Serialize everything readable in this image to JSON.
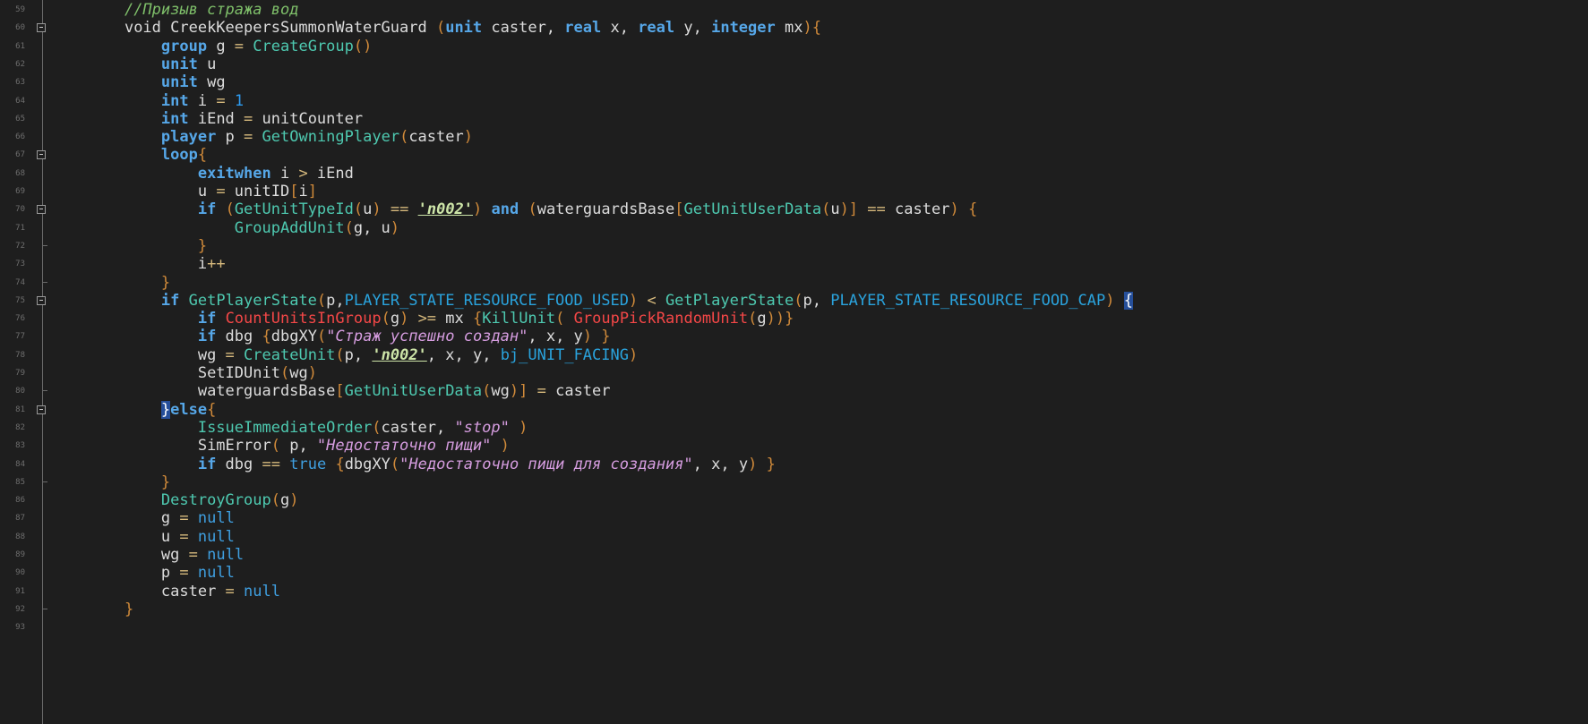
{
  "editor": {
    "lines": [
      {
        "n": "59",
        "fold": "none",
        "tokens": [
          [
            "",
            "    "
          ],
          [
            "cmt",
            "//Призыв стража вод"
          ]
        ]
      },
      {
        "n": "60",
        "fold": "open",
        "tokens": [
          [
            "",
            "    "
          ],
          [
            "id",
            "void CreekKeepersSummonWaterGuard "
          ],
          [
            "pun",
            "("
          ],
          [
            "type",
            "unit"
          ],
          [
            "id",
            " caster, "
          ],
          [
            "type",
            "real"
          ],
          [
            "id",
            " x, "
          ],
          [
            "type",
            "real"
          ],
          [
            "id",
            " y, "
          ],
          [
            "type",
            "integer"
          ],
          [
            "id",
            " mx"
          ],
          [
            "pun",
            "){"
          ]
        ]
      },
      {
        "n": "61",
        "fold": "none",
        "tokens": [
          [
            "",
            "        "
          ],
          [
            "type",
            "group"
          ],
          [
            "id",
            " g "
          ],
          [
            "op",
            "="
          ],
          [
            "id",
            " "
          ],
          [
            "fn",
            "CreateGroup"
          ],
          [
            "pun",
            "()"
          ]
        ]
      },
      {
        "n": "62",
        "fold": "none",
        "tokens": [
          [
            "",
            "        "
          ],
          [
            "type",
            "unit"
          ],
          [
            "id",
            " u"
          ]
        ]
      },
      {
        "n": "63",
        "fold": "none",
        "tokens": [
          [
            "",
            "        "
          ],
          [
            "type",
            "unit"
          ],
          [
            "id",
            " wg"
          ]
        ]
      },
      {
        "n": "64",
        "fold": "none",
        "tokens": [
          [
            "",
            "        "
          ],
          [
            "type",
            "int"
          ],
          [
            "id",
            " i "
          ],
          [
            "op",
            "="
          ],
          [
            "id",
            " "
          ],
          [
            "num",
            "1"
          ]
        ]
      },
      {
        "n": "65",
        "fold": "none",
        "tokens": [
          [
            "",
            "        "
          ],
          [
            "type",
            "int"
          ],
          [
            "id",
            " iEnd "
          ],
          [
            "op",
            "="
          ],
          [
            "id",
            " unitCounter"
          ]
        ]
      },
      {
        "n": "66",
        "fold": "none",
        "tokens": [
          [
            "",
            "        "
          ],
          [
            "type",
            "player"
          ],
          [
            "id",
            " p "
          ],
          [
            "op",
            "="
          ],
          [
            "id",
            " "
          ],
          [
            "fn",
            "GetOwningPlayer"
          ],
          [
            "pun",
            "("
          ],
          [
            "id",
            "caster"
          ],
          [
            "pun",
            ")"
          ]
        ]
      },
      {
        "n": "67",
        "fold": "open",
        "tokens": [
          [
            "",
            "        "
          ],
          [
            "type",
            "loop"
          ],
          [
            "pun",
            "{"
          ]
        ]
      },
      {
        "n": "68",
        "fold": "none",
        "tokens": [
          [
            "",
            "            "
          ],
          [
            "type",
            "exitwhen"
          ],
          [
            "id",
            " i "
          ],
          [
            "op",
            ">"
          ],
          [
            "id",
            " iEnd"
          ]
        ]
      },
      {
        "n": "69",
        "fold": "none",
        "tokens": [
          [
            "",
            "            "
          ],
          [
            "id",
            "u "
          ],
          [
            "op",
            "="
          ],
          [
            "id",
            " unitID"
          ],
          [
            "pun",
            "["
          ],
          [
            "id",
            "i"
          ],
          [
            "pun",
            "]"
          ]
        ]
      },
      {
        "n": "70",
        "fold": "open",
        "tokens": [
          [
            "",
            "            "
          ],
          [
            "type",
            "if"
          ],
          [
            "id",
            " "
          ],
          [
            "pun",
            "("
          ],
          [
            "fn",
            "GetUnitTypeId"
          ],
          [
            "pun",
            "("
          ],
          [
            "id",
            "u"
          ],
          [
            "pun",
            ")"
          ],
          [
            "id",
            " "
          ],
          [
            "op",
            "=="
          ],
          [
            "id",
            " "
          ],
          [
            "raw",
            "'n002'"
          ],
          [
            "pun",
            ")"
          ],
          [
            "id",
            " "
          ],
          [
            "type",
            "and"
          ],
          [
            "id",
            " "
          ],
          [
            "pun",
            "("
          ],
          [
            "id",
            "waterguardsBase"
          ],
          [
            "pun",
            "["
          ],
          [
            "fn",
            "GetUnitUserData"
          ],
          [
            "pun",
            "("
          ],
          [
            "id",
            "u"
          ],
          [
            "pun",
            ")]"
          ],
          [
            "id",
            " "
          ],
          [
            "op",
            "=="
          ],
          [
            "id",
            " caster"
          ],
          [
            "pun",
            ")"
          ],
          [
            "id",
            " "
          ],
          [
            "pun",
            "{"
          ]
        ]
      },
      {
        "n": "71",
        "fold": "none",
        "tokens": [
          [
            "",
            "                "
          ],
          [
            "fn",
            "GroupAddUnit"
          ],
          [
            "pun",
            "("
          ],
          [
            "id",
            "g, u"
          ],
          [
            "pun",
            ")"
          ]
        ]
      },
      {
        "n": "72",
        "fold": "end",
        "tokens": [
          [
            "",
            "            "
          ],
          [
            "pun",
            "}"
          ]
        ]
      },
      {
        "n": "73",
        "fold": "none",
        "tokens": [
          [
            "",
            "            "
          ],
          [
            "id",
            "i"
          ],
          [
            "op",
            "++"
          ]
        ]
      },
      {
        "n": "74",
        "fold": "end",
        "tokens": [
          [
            "",
            "        "
          ],
          [
            "pun",
            "}"
          ]
        ]
      },
      {
        "n": "75",
        "fold": "open",
        "tokens": [
          [
            "",
            "        "
          ],
          [
            "type",
            "if"
          ],
          [
            "id",
            " "
          ],
          [
            "fn",
            "GetPlayerState"
          ],
          [
            "pun",
            "("
          ],
          [
            "id",
            "p,"
          ],
          [
            "const",
            "PLAYER_STATE_RESOURCE_FOOD_USED"
          ],
          [
            "pun",
            ")"
          ],
          [
            "id",
            " "
          ],
          [
            "op",
            "<"
          ],
          [
            "id",
            " "
          ],
          [
            "fn",
            "GetPlayerState"
          ],
          [
            "pun",
            "("
          ],
          [
            "id",
            "p, "
          ],
          [
            "const",
            "PLAYER_STATE_RESOURCE_FOOD_CAP"
          ],
          [
            "pun",
            ")"
          ],
          [
            "id",
            " "
          ],
          [
            "sel",
            "{"
          ]
        ]
      },
      {
        "n": "76",
        "fold": "none",
        "tokens": [
          [
            "",
            "            "
          ],
          [
            "type",
            "if"
          ],
          [
            "id",
            " "
          ],
          [
            "fnr",
            "CountUnitsInGroup"
          ],
          [
            "pun",
            "("
          ],
          [
            "id",
            "g"
          ],
          [
            "pun",
            ")"
          ],
          [
            "id",
            " "
          ],
          [
            "op",
            ">="
          ],
          [
            "id",
            " mx "
          ],
          [
            "pun",
            "{"
          ],
          [
            "fn",
            "KillUnit"
          ],
          [
            "pun",
            "("
          ],
          [
            "id",
            " "
          ],
          [
            "fnr",
            "GroupPickRandomUnit"
          ],
          [
            "pun",
            "("
          ],
          [
            "id",
            "g"
          ],
          [
            "pun",
            "))}"
          ]
        ]
      },
      {
        "n": "77",
        "fold": "none",
        "tokens": [
          [
            "",
            "            "
          ],
          [
            "type",
            "if"
          ],
          [
            "id",
            " dbg "
          ],
          [
            "pun",
            "{"
          ],
          [
            "id",
            "dbgXY"
          ],
          [
            "pun",
            "("
          ],
          [
            "str",
            "\"Страж успешно создан\""
          ],
          [
            "id",
            ", x, y"
          ],
          [
            "pun",
            ")"
          ],
          [
            "id",
            " "
          ],
          [
            "pun",
            "}"
          ]
        ]
      },
      {
        "n": "78",
        "fold": "none",
        "tokens": [
          [
            "",
            "            "
          ],
          [
            "id",
            "wg "
          ],
          [
            "op",
            "="
          ],
          [
            "id",
            " "
          ],
          [
            "fn",
            "CreateUnit"
          ],
          [
            "pun",
            "("
          ],
          [
            "id",
            "p, "
          ],
          [
            "raw",
            "'n002'"
          ],
          [
            "id",
            ", x, y, "
          ],
          [
            "const",
            "bj_UNIT_FACING"
          ],
          [
            "pun",
            ")"
          ]
        ]
      },
      {
        "n": "79",
        "fold": "none",
        "tokens": [
          [
            "",
            "            "
          ],
          [
            "id",
            "SetIDUnit"
          ],
          [
            "pun",
            "("
          ],
          [
            "id",
            "wg"
          ],
          [
            "pun",
            ")"
          ]
        ]
      },
      {
        "n": "80",
        "fold": "end",
        "tokens": [
          [
            "",
            "            "
          ],
          [
            "id",
            "waterguardsBase"
          ],
          [
            "pun",
            "["
          ],
          [
            "fn",
            "GetUnitUserData"
          ],
          [
            "pun",
            "("
          ],
          [
            "id",
            "wg"
          ],
          [
            "pun",
            ")]"
          ],
          [
            "id",
            " "
          ],
          [
            "op",
            "="
          ],
          [
            "id",
            " caster"
          ]
        ]
      },
      {
        "n": "81",
        "fold": "open",
        "tokens": [
          [
            "",
            "        "
          ],
          [
            "sel",
            "}"
          ],
          [
            "type",
            "else"
          ],
          [
            "pun",
            "{"
          ]
        ]
      },
      {
        "n": "82",
        "fold": "none",
        "tokens": [
          [
            "",
            "            "
          ],
          [
            "fn",
            "IssueImmediateOrder"
          ],
          [
            "pun",
            "("
          ],
          [
            "id",
            "caster, "
          ],
          [
            "str",
            "\"stop\""
          ],
          [
            "id",
            " "
          ],
          [
            "pun",
            ")"
          ]
        ]
      },
      {
        "n": "83",
        "fold": "none",
        "tokens": [
          [
            "",
            "            "
          ],
          [
            "id",
            "SimError"
          ],
          [
            "pun",
            "("
          ],
          [
            "id",
            " p, "
          ],
          [
            "str",
            "\"Недостаточно пищи\""
          ],
          [
            "id",
            " "
          ],
          [
            "pun",
            ")"
          ]
        ]
      },
      {
        "n": "84",
        "fold": "none",
        "tokens": [
          [
            "",
            "            "
          ],
          [
            "type",
            "if"
          ],
          [
            "id",
            " dbg "
          ],
          [
            "op",
            "=="
          ],
          [
            "id",
            " "
          ],
          [
            "kwn",
            "true"
          ],
          [
            "id",
            " "
          ],
          [
            "pun",
            "{"
          ],
          [
            "id",
            "dbgXY"
          ],
          [
            "pun",
            "("
          ],
          [
            "str",
            "\"Недостаточно пищи для создания\""
          ],
          [
            "id",
            ", x, y"
          ],
          [
            "pun",
            ")"
          ],
          [
            "id",
            " "
          ],
          [
            "pun",
            "}"
          ]
        ]
      },
      {
        "n": "85",
        "fold": "end",
        "tokens": [
          [
            "",
            "        "
          ],
          [
            "pun",
            "}"
          ]
        ]
      },
      {
        "n": "86",
        "fold": "none",
        "tokens": [
          [
            "",
            "        "
          ],
          [
            "fn",
            "DestroyGroup"
          ],
          [
            "pun",
            "("
          ],
          [
            "id",
            "g"
          ],
          [
            "pun",
            ")"
          ]
        ]
      },
      {
        "n": "87",
        "fold": "none",
        "tokens": [
          [
            "",
            "        "
          ],
          [
            "id",
            "g "
          ],
          [
            "op",
            "="
          ],
          [
            "id",
            " "
          ],
          [
            "kwn",
            "null"
          ]
        ]
      },
      {
        "n": "88",
        "fold": "none",
        "tokens": [
          [
            "",
            "        "
          ],
          [
            "id",
            "u "
          ],
          [
            "op",
            "="
          ],
          [
            "id",
            " "
          ],
          [
            "kwn",
            "null"
          ]
        ]
      },
      {
        "n": "89",
        "fold": "none",
        "tokens": [
          [
            "",
            "        "
          ],
          [
            "id",
            "wg "
          ],
          [
            "op",
            "="
          ],
          [
            "id",
            " "
          ],
          [
            "kwn",
            "null"
          ]
        ]
      },
      {
        "n": "90",
        "fold": "none",
        "tokens": [
          [
            "",
            "        "
          ],
          [
            "id",
            "p "
          ],
          [
            "op",
            "="
          ],
          [
            "id",
            " "
          ],
          [
            "kwn",
            "null"
          ]
        ]
      },
      {
        "n": "91",
        "fold": "none",
        "tokens": [
          [
            "",
            "        "
          ],
          [
            "id",
            "caster "
          ],
          [
            "op",
            "="
          ],
          [
            "id",
            " "
          ],
          [
            "kwn",
            "null"
          ]
        ]
      },
      {
        "n": "92",
        "fold": "end",
        "tokens": [
          [
            "",
            "    "
          ],
          [
            "pun",
            "}"
          ]
        ]
      },
      {
        "n": "93",
        "fold": "none",
        "tokens": []
      }
    ]
  }
}
